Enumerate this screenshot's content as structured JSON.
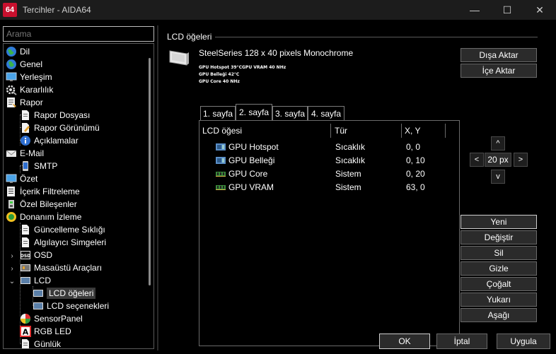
{
  "window": {
    "app_icon_text": "64",
    "title": "Tercihler - AIDA64",
    "minimize": "—",
    "maximize": "☐",
    "close": "✕"
  },
  "search": {
    "placeholder": "Arama"
  },
  "tree": [
    {
      "label": "Dil",
      "icon": "globe-icon"
    },
    {
      "label": "Genel",
      "icon": "globe-icon"
    },
    {
      "label": "Yerleşim",
      "icon": "monitor-icon"
    },
    {
      "label": "Kararlılık",
      "icon": "gear-icon"
    },
    {
      "label": "Rapor",
      "icon": "report-icon"
    },
    {
      "label": "Rapor Dosyası",
      "icon": "document-icon"
    },
    {
      "label": "Rapor Görünümü",
      "icon": "document-edit-icon"
    },
    {
      "label": "Açıklamalar",
      "icon": "info-icon"
    },
    {
      "label": "E-Mail",
      "icon": "email-icon"
    },
    {
      "label": "SMTP",
      "icon": "phone-icon"
    },
    {
      "label": "Özet",
      "icon": "monitor-icon"
    },
    {
      "label": "İçerik Filtreleme",
      "icon": "filter-icon"
    },
    {
      "label": "Özel Bileşenler",
      "icon": "component-icon"
    },
    {
      "label": "Donanım İzleme",
      "icon": "hardware-monitor-icon"
    },
    {
      "label": "Güncelleme Sıklığı",
      "icon": "document-icon"
    },
    {
      "label": "Algılayıcı Simgeleri",
      "icon": "document-icon"
    },
    {
      "label": "OSD",
      "icon": "osd-icon"
    },
    {
      "label": "Masaüstü Araçları",
      "icon": "desktop-gadget-icon"
    },
    {
      "label": "LCD",
      "icon": "lcd-icon"
    },
    {
      "label": "LCD öğeleri",
      "icon": "lcd-icon"
    },
    {
      "label": "LCD seçenekleri",
      "icon": "lcd-icon"
    },
    {
      "label": "SensorPanel",
      "icon": "sensorpanel-icon"
    },
    {
      "label": "RGB LED",
      "icon": "rgb-led-icon"
    },
    {
      "label": "Günlük",
      "icon": "document-icon"
    }
  ],
  "panel": {
    "title": "LCD öğeleri",
    "device": "SteelSeries 128 x 40 pixels Monochrome",
    "preview_lines": [
      "GPU Hotspot 39°CGPU VRAM  40 NHz",
      "GPU Belleği 42°C",
      "GPU Core 40 NHz"
    ],
    "export_label": "Dışa Aktar",
    "import_label": "İçe Aktar",
    "tabs": [
      "1. sayfa",
      "2. sayfa",
      "3. sayfa",
      "4. sayfa"
    ],
    "active_tab": 1
  },
  "list": {
    "columns": [
      "LCD öğesi",
      "Tür",
      "X, Y"
    ],
    "rows": [
      {
        "item": "GPU Hotspot",
        "type": "Sıcaklık",
        "xy": "0, 0",
        "icon": "gpu-icon"
      },
      {
        "item": "GPU Belleği",
        "type": "Sıcaklık",
        "xy": "0, 10",
        "icon": "gpu-icon"
      },
      {
        "item": "GPU Core",
        "type": "Sistem",
        "xy": "0, 20",
        "icon": "memory-chip-icon"
      },
      {
        "item": "GPU VRAM",
        "type": "Sistem",
        "xy": "63, 0",
        "icon": "memory-chip-icon"
      }
    ]
  },
  "nav": {
    "up": "^",
    "down": "v",
    "left": "<",
    "right": ">",
    "step": "20 px"
  },
  "actions": {
    "new": "Yeni",
    "edit": "Değiştir",
    "delete": "Sil",
    "hide": "Gizle",
    "duplicate": "Çoğalt",
    "up": "Yukarı",
    "down": "Aşağı"
  },
  "footer": {
    "ok": "OK",
    "cancel": "İptal",
    "apply": "Uygula"
  }
}
